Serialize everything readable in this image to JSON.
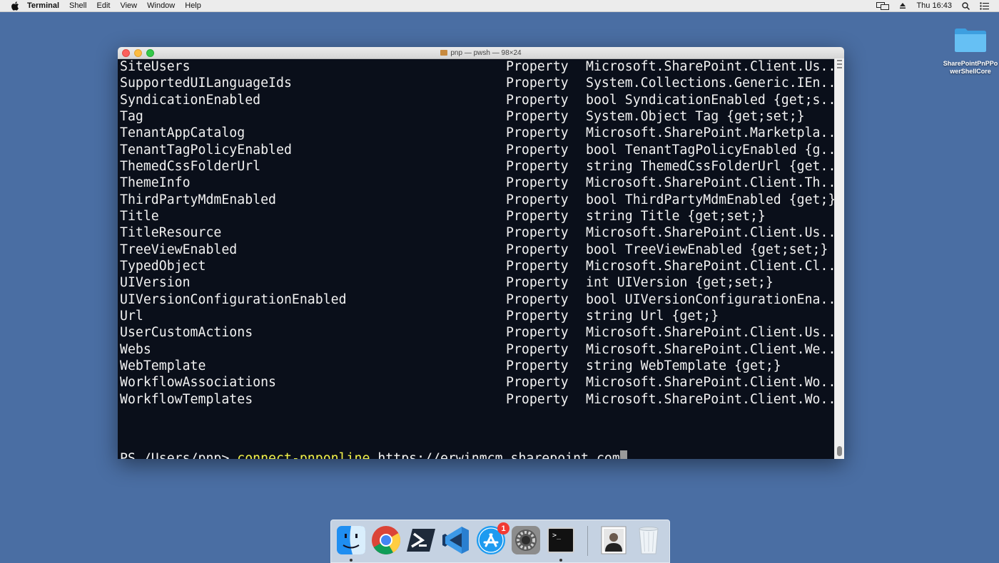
{
  "menubar": {
    "app_name": "Terminal",
    "items": [
      "Shell",
      "Edit",
      "View",
      "Window",
      "Help"
    ],
    "clock": "Thu 16:43"
  },
  "desktop": {
    "folder_label": "SharePointPnPPowerShellCore"
  },
  "window": {
    "title": "pnp — pwsh — 98×24",
    "rows": [
      {
        "name": "SiteUsers",
        "type": "Property",
        "definition": "Microsoft.SharePoint.Client.Us..."
      },
      {
        "name": "SupportedUILanguageIds",
        "type": "Property",
        "definition": "System.Collections.Generic.IEn..."
      },
      {
        "name": "SyndicationEnabled",
        "type": "Property",
        "definition": "bool SyndicationEnabled {get;s..."
      },
      {
        "name": "Tag",
        "type": "Property",
        "definition": "System.Object Tag {get;set;}"
      },
      {
        "name": "TenantAppCatalog",
        "type": "Property",
        "definition": "Microsoft.SharePoint.Marketpla..."
      },
      {
        "name": "TenantTagPolicyEnabled",
        "type": "Property",
        "definition": "bool TenantTagPolicyEnabled {g..."
      },
      {
        "name": "ThemedCssFolderUrl",
        "type": "Property",
        "definition": "string ThemedCssFolderUrl {get..."
      },
      {
        "name": "ThemeInfo",
        "type": "Property",
        "definition": "Microsoft.SharePoint.Client.Th..."
      },
      {
        "name": "ThirdPartyMdmEnabled",
        "type": "Property",
        "definition": "bool ThirdPartyMdmEnabled {get;}"
      },
      {
        "name": "Title",
        "type": "Property",
        "definition": "string Title {get;set;}"
      },
      {
        "name": "TitleResource",
        "type": "Property",
        "definition": "Microsoft.SharePoint.Client.Us..."
      },
      {
        "name": "TreeViewEnabled",
        "type": "Property",
        "definition": "bool TreeViewEnabled {get;set;}"
      },
      {
        "name": "TypedObject",
        "type": "Property",
        "definition": "Microsoft.SharePoint.Client.Cl..."
      },
      {
        "name": "UIVersion",
        "type": "Property",
        "definition": "int UIVersion {get;set;}"
      },
      {
        "name": "UIVersionConfigurationEnabled",
        "type": "Property",
        "definition": "bool UIVersionConfigurationEna..."
      },
      {
        "name": "Url",
        "type": "Property",
        "definition": "string Url {get;}"
      },
      {
        "name": "UserCustomActions",
        "type": "Property",
        "definition": "Microsoft.SharePoint.Client.Us..."
      },
      {
        "name": "Webs",
        "type": "Property",
        "definition": "Microsoft.SharePoint.Client.We..."
      },
      {
        "name": "WebTemplate",
        "type": "Property",
        "definition": "string WebTemplate {get;}"
      },
      {
        "name": "WorkflowAssociations",
        "type": "Property",
        "definition": "Microsoft.SharePoint.Client.Wo..."
      },
      {
        "name": "WorkflowTemplates",
        "type": "Property",
        "definition": "Microsoft.SharePoint.Client.Wo..."
      }
    ],
    "prompt": "PS /Users/pnp> ",
    "command": "connect-pnponline",
    "argument": " https://erwinmcm.sharepoint.com"
  },
  "dock": {
    "items": [
      "finder-icon",
      "chrome-icon",
      "powershell-icon",
      "vscode-icon",
      "app-store-icon",
      "system-preferences-icon",
      "terminal-icon",
      "user-photo-icon",
      "trash-icon"
    ],
    "app_store_badge": "1",
    "terminal_glyph": ">_"
  },
  "colors": {
    "desktop": "#4a6ea3",
    "terminal_bg": "#0a0f1a",
    "terminal_fg": "#f2f2f2",
    "command": "#f2f24a"
  }
}
